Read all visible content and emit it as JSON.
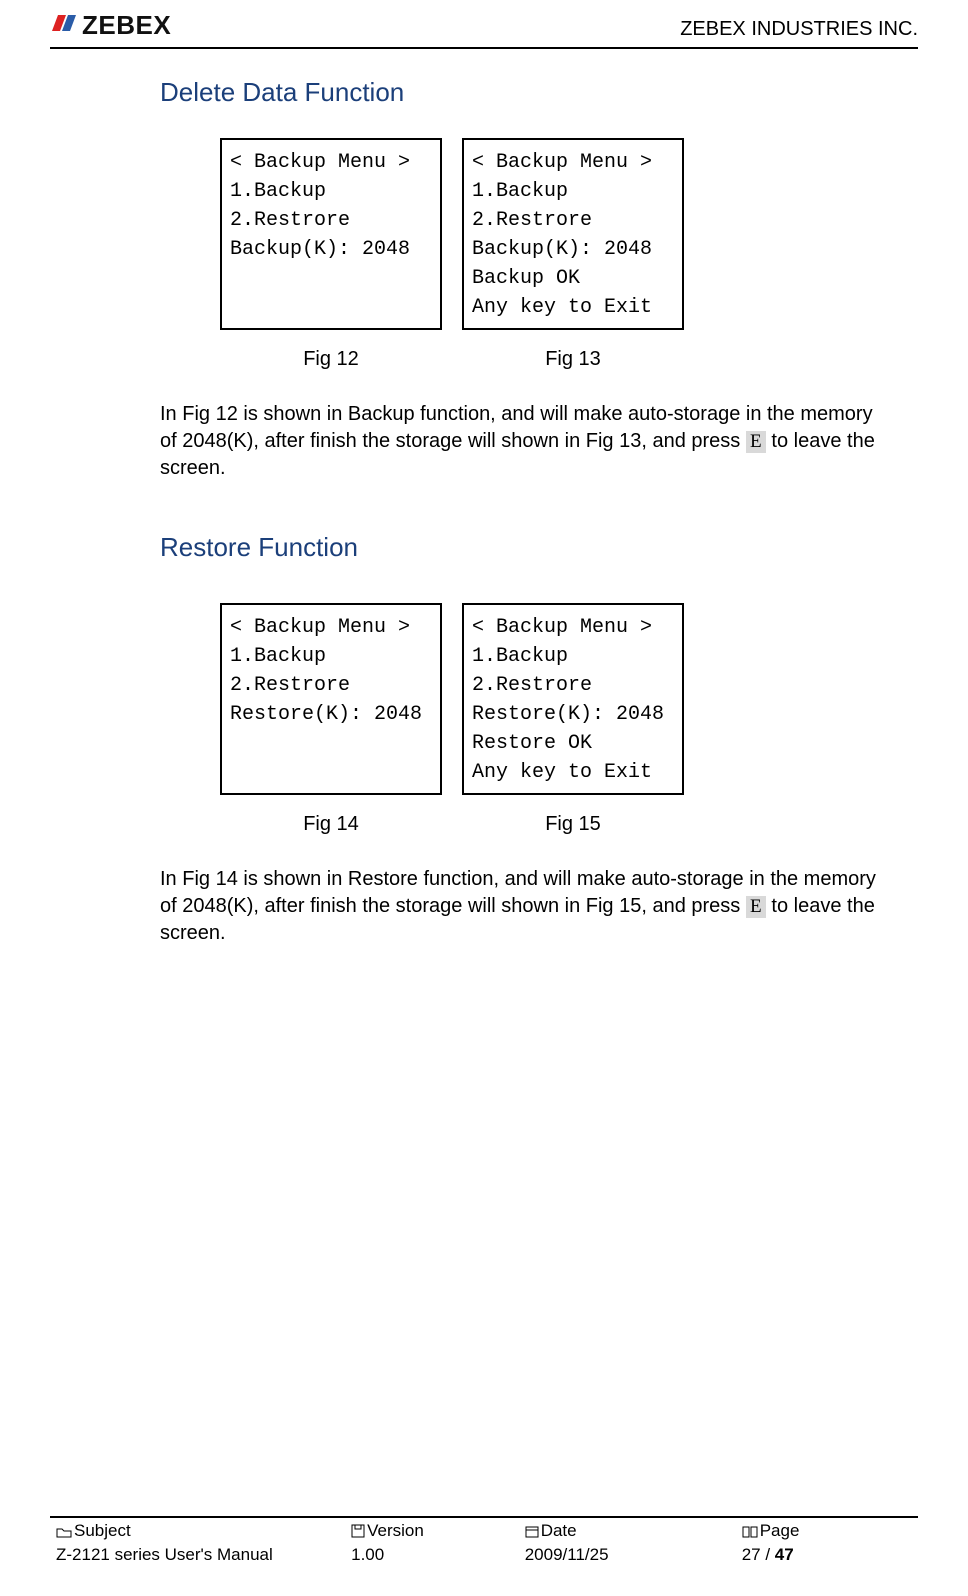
{
  "header": {
    "logo_text": "ZEBEX",
    "company": "ZEBEX INDUSTRIES INC."
  },
  "sections": {
    "delete": {
      "title": "Delete Data Function",
      "fig_a_caption": "Fig 12",
      "fig_b_caption": "Fig 13",
      "screen_a": {
        "l1": "< Backup Menu >",
        "l2": "1.Backup",
        "l3": "2.Restrore",
        "l4": "Backup(K): 2048"
      },
      "screen_b": {
        "l1": "< Backup Menu >",
        "l2": "1.Backup",
        "l3": "2.Restrore",
        "l4": "Backup(K): 2048",
        "l5": "Backup OK",
        "l6": "Any key to Exit"
      },
      "para_before_key": "In Fig 12 is shown in Backup function, and will make auto-storage in the memory of 2048(K), after finish the storage will shown in Fig 13, and press ",
      "key": "E",
      "para_after_key": " to leave the screen."
    },
    "restore": {
      "title": "Restore Function",
      "fig_a_caption": "Fig 14",
      "fig_b_caption": "Fig 15",
      "screen_a": {
        "l1": "< Backup Menu >",
        "l2": "1.Backup",
        "l3": "2.Restrore",
        "l4": "Restore(K): 2048"
      },
      "screen_b": {
        "l1": "< Backup Menu >",
        "l2": "1.Backup",
        "l3": "2.Restrore",
        "l4": "Restore(K): 2048",
        "l5": "Restore OK",
        "l6": "Any key to Exit"
      },
      "para_before_key": "In Fig 14 is shown in Restore function, and will make auto-storage in the memory of 2048(K), after finish the storage will shown in Fig 15, and press ",
      "key": "E",
      "para_after_key": " to leave the screen."
    }
  },
  "footer": {
    "labels": {
      "subject": "Subject",
      "version": "Version",
      "date": "Date",
      "page": "Page"
    },
    "values": {
      "subject": "Z-2121 series User's Manual",
      "version": "1.00",
      "date": "2009/11/25",
      "page_current": "27",
      "page_sep": " / ",
      "page_total": "47"
    }
  }
}
